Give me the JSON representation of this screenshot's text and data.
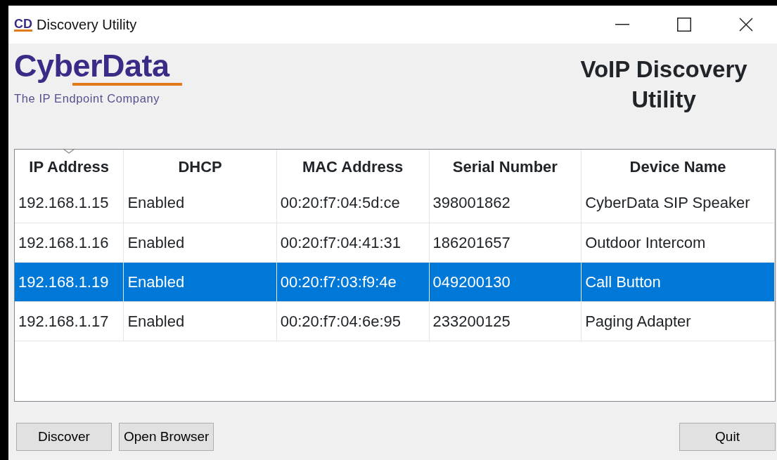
{
  "window": {
    "icon_text": "CD",
    "title": "Discovery Utility"
  },
  "logo": {
    "name": "CyberData",
    "tagline": "The IP Endpoint Company"
  },
  "heading": "VoIP Discovery Utility",
  "table": {
    "columns": [
      {
        "label": "IP Address",
        "sorted": true
      },
      {
        "label": "DHCP",
        "sorted": false
      },
      {
        "label": "MAC Address",
        "sorted": false
      },
      {
        "label": "Serial Number",
        "sorted": false
      },
      {
        "label": "Device Name",
        "sorted": false
      }
    ],
    "rows": [
      {
        "cells": [
          "192.168.1.15",
          "Enabled",
          "00:20:f7:04:5d:ce",
          "398001862",
          "CyberData SIP Speaker"
        ],
        "selected": false
      },
      {
        "cells": [
          "192.168.1.16",
          "Enabled",
          "00:20:f7:04:41:31",
          "186201657",
          "Outdoor Intercom"
        ],
        "selected": false
      },
      {
        "cells": [
          "192.168.1.19",
          "Enabled",
          "00:20:f7:03:f9:4e",
          "049200130",
          "Call Button"
        ],
        "selected": true
      },
      {
        "cells": [
          "192.168.1.17",
          "Enabled",
          "00:20:f7:04:6e:95",
          "233200125",
          "Paging Adapter"
        ],
        "selected": false
      }
    ]
  },
  "buttons_left": [
    "Discover",
    "Open Browser"
  ],
  "buttons_right": [
    "Quit"
  ]
}
